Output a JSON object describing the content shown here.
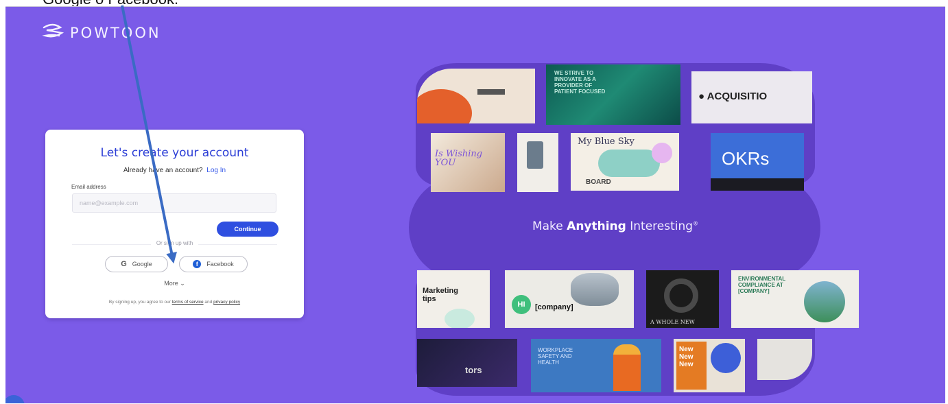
{
  "doc_caption": "Google o Facebook.",
  "brand": {
    "name": "POWTOON"
  },
  "signup": {
    "title": "Let's create your account",
    "have_account": "Already have an account?",
    "login_link": "Log In",
    "email_label": "Email address",
    "email_placeholder": "name@example.com",
    "continue_label": "Continue",
    "divider": "Or sign up with",
    "google_label": "Google",
    "facebook_label": "Facebook",
    "more_label": "More",
    "terms_prefix": "By signing up, you agree to our",
    "terms_link": "terms of service",
    "terms_and": "and",
    "privacy_link": "privacy policy"
  },
  "promo": {
    "tagline_pre": "Make",
    "tagline_bold": "Anything",
    "tagline_post": "Interesting",
    "tagline_mark": "®",
    "tiles": {
      "strive": "WE STRIVE TO INNOVATE AS A PROVIDER OF PATIENT FOCUSED",
      "acquisition": "ACQUISITIO",
      "wishing": "Is Wishing YOU",
      "blue_sky": "My Blue Sky",
      "board": "BOARD",
      "okrs": "OKRs",
      "marketing": "Marketing tips",
      "hi": "HI",
      "company": "[company]",
      "whole_new": "A WHOLE NEW",
      "env": "ENVIRONMENTAL COMPLIANCE AT [COMPANY]",
      "workplace": "WORKPLACE SAFETY AND HEALTH",
      "new_new": "New New New",
      "tors": "tors"
    }
  },
  "colors": {
    "background": "#7b5be8",
    "accent": "#2f4fe0",
    "blob": "#5f3fc6",
    "arrow": "#3a6bc4"
  }
}
